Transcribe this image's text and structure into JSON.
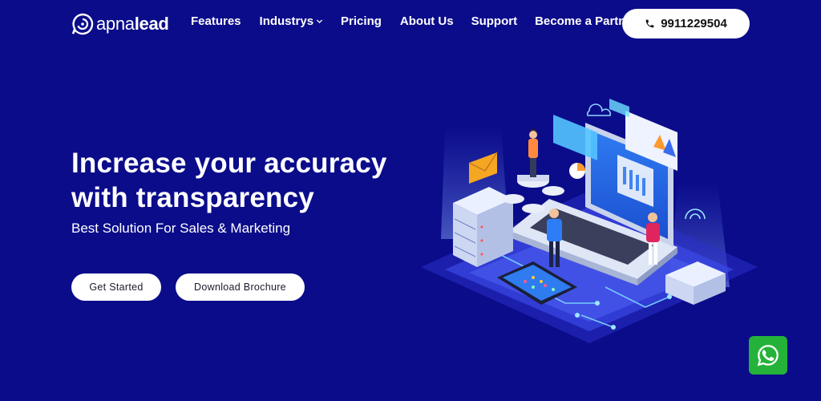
{
  "header": {
    "logo": {
      "light": "apna",
      "bold": "lead"
    },
    "nav": [
      {
        "label": "Features",
        "has_dropdown": false
      },
      {
        "label": "Industrys",
        "has_dropdown": true
      },
      {
        "label": "Pricing",
        "has_dropdown": false
      },
      {
        "label": "About Us",
        "has_dropdown": false
      },
      {
        "label": "Support",
        "has_dropdown": false
      },
      {
        "label": "Become a Partner",
        "has_dropdown": false
      }
    ],
    "phone": "9911229504",
    "phone_icon": "phone-icon"
  },
  "hero": {
    "title_line1": "Increase your accuracy",
    "title_line2": "with transparency",
    "subtitle": "Best Solution For Sales & Marketing",
    "primary_button": "Get Started",
    "secondary_button": "Download Brochure"
  },
  "illustration": {
    "icon": "isometric-laptop-illustration"
  },
  "whatsapp": {
    "icon": "whatsapp-icon"
  },
  "colors": {
    "background": "#0b0c8a",
    "button_bg": "#ffffff",
    "whatsapp": "#25b23a"
  }
}
